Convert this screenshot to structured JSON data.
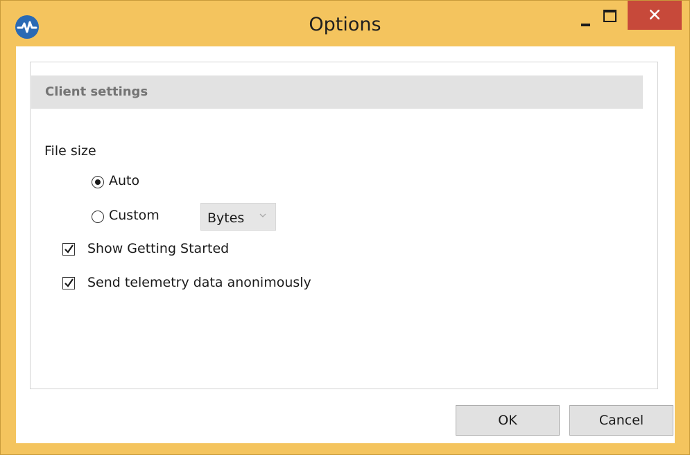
{
  "window": {
    "title": "Options",
    "colors": {
      "frame": "#f4c45e",
      "close_button": "#c7493a",
      "app_icon": "#2a6ab4"
    },
    "icons": {
      "app": "pulse-icon",
      "minimize": "minimize-icon",
      "maximize": "maximize-icon",
      "close": "close-icon"
    }
  },
  "client_settings": {
    "header": "Client settings",
    "file_size": {
      "label": "File size",
      "options": [
        {
          "label": "Auto",
          "selected": true
        },
        {
          "label": "Custom",
          "selected": false
        }
      ],
      "unit_select": {
        "value": "Bytes",
        "icon": "chevron-down-icon"
      }
    },
    "checkboxes": [
      {
        "label": "Show Getting Started",
        "checked": true
      },
      {
        "label": "Send telemetry data anonimously",
        "checked": true
      }
    ]
  },
  "footer": {
    "ok_label": "OK",
    "cancel_label": "Cancel"
  }
}
